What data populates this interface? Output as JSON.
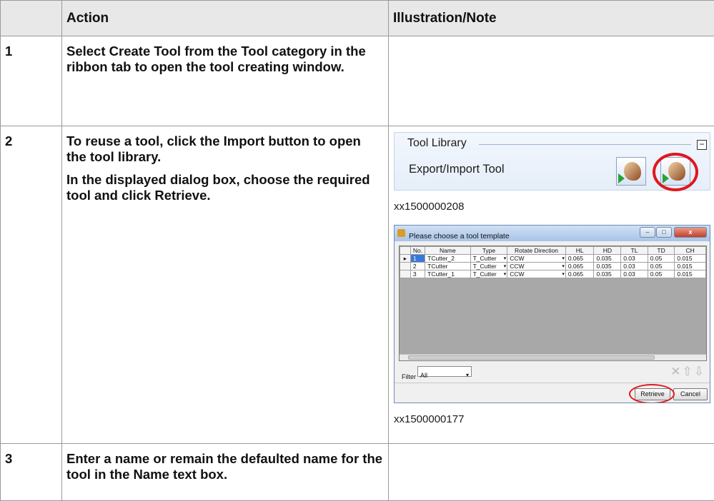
{
  "table": {
    "headers": [
      "",
      "Action",
      "Illustration/Note"
    ],
    "rows": [
      {
        "step": "1",
        "action": [
          [
            {
              "t": "Select ",
              "b": false
            },
            {
              "t": "Create Tool",
              "b": true
            },
            {
              "t": " from the ",
              "b": false
            },
            {
              "t": "Tool",
              "b": true
            },
            {
              "t": " category in the ribbon tab to open the tool creating window.",
              "b": false
            }
          ]
        ]
      },
      {
        "step": "2",
        "action": [
          [
            {
              "t": "To reuse a tool, click the ",
              "b": false
            },
            {
              "t": "Import",
              "b": true
            },
            {
              "t": " button to open the tool library.",
              "b": false
            }
          ],
          [
            {
              "t": "In the displayed dialog box, choose the required tool and click ",
              "b": false
            },
            {
              "t": "Retrieve",
              "b": true
            },
            {
              "t": ".",
              "b": false
            }
          ]
        ]
      },
      {
        "step": "3",
        "action": [
          [
            {
              "t": "Enter a name or remain the defaulted name for the tool in the ",
              "b": false
            },
            {
              "t": "Name",
              "b": true
            },
            {
              "t": " text box.",
              "b": false
            }
          ]
        ]
      }
    ]
  },
  "tool_library": {
    "title": "Tool Library",
    "collapse_symbol": "−",
    "label": "Export/Import Tool",
    "caption": "xx1500000208"
  },
  "dialog": {
    "title": "Please choose a tool template",
    "columns": [
      "No.",
      "Name",
      "Type",
      "Rotate Direction",
      "HL",
      "HD",
      "TL",
      "TD",
      "CH"
    ],
    "rows": [
      [
        "1",
        "TCutter_2",
        "T_Cutter",
        "CCW",
        "0.065",
        "0.035",
        "0.03",
        "0.05",
        "0.015"
      ],
      [
        "2",
        "TCutter",
        "T_Cutter",
        "CCW",
        "0.065",
        "0.035",
        "0.03",
        "0.05",
        "0.015"
      ],
      [
        "3",
        "TCutter_1",
        "T_Cutter",
        "CCW",
        "0.065",
        "0.035",
        "0.03",
        "0.05",
        "0.015"
      ]
    ],
    "selected_row_marker": "▸",
    "filter_label": "Filter",
    "filter_value": "All",
    "retrieve_label": "Retrieve",
    "cancel_label": "Cancel",
    "caption": "xx1500000177"
  }
}
